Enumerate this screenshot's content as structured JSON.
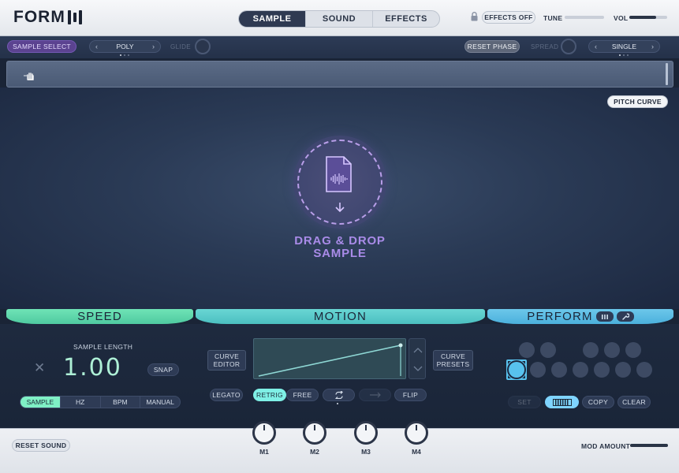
{
  "app": {
    "logo_text": "FORM",
    "tabs": [
      {
        "label": "SAMPLE",
        "active": true
      },
      {
        "label": "SOUND",
        "active": false
      },
      {
        "label": "EFFECTS",
        "active": false
      }
    ],
    "effects_off_label": "EFFECTS OFF",
    "tune_label": "TUNE",
    "vol_label": "VOL",
    "tune_level": 0.5,
    "vol_level": 0.7
  },
  "subbar": {
    "sample_select_label": "SAMPLE SELECT",
    "voice_mode": "POLY",
    "glide_label": "GLIDE",
    "reset_phase_label": "RESET PHASE",
    "spread_label": "SPREAD",
    "unison_mode": "SINGLE"
  },
  "main": {
    "pitch_curve_label": "PITCH CURVE",
    "drop_line1": "DRAG & DROP",
    "drop_line2": "SAMPLE"
  },
  "speed": {
    "title": "SPEED",
    "sample_length_label": "SAMPLE LENGTH",
    "value": "1.00",
    "snap_label": "SNAP",
    "modes": [
      "SAMPLE",
      "HZ",
      "BPM",
      "MANUAL"
    ],
    "active_mode": "SAMPLE"
  },
  "motion": {
    "title": "MOTION",
    "curve_editor_line1": "CURVE",
    "curve_editor_line2": "EDITOR",
    "curve_presets_line1": "CURVE",
    "curve_presets_line2": "PRESETS",
    "legato_label": "LEGATO",
    "retrig_label": "RETRIG",
    "free_label": "FREE",
    "flip_label": "FLIP",
    "loop_icon": "loop-icon",
    "arrow_icon": "arrow-right-icon"
  },
  "perform": {
    "title": "PERFORM",
    "set_label": "SET",
    "copy_label": "COPY",
    "clear_label": "CLEAR"
  },
  "bottom": {
    "reset_sound_label": "RESET SOUND",
    "macros": [
      "M1",
      "M2",
      "M3",
      "M4"
    ],
    "mod_amount_label": "MOD AMOUNT"
  },
  "colors": {
    "speed_accent": "#6fe3b6",
    "motion_accent": "#69d6d4",
    "perform_accent": "#6cc7ea",
    "drop_accent": "#a98be8"
  }
}
